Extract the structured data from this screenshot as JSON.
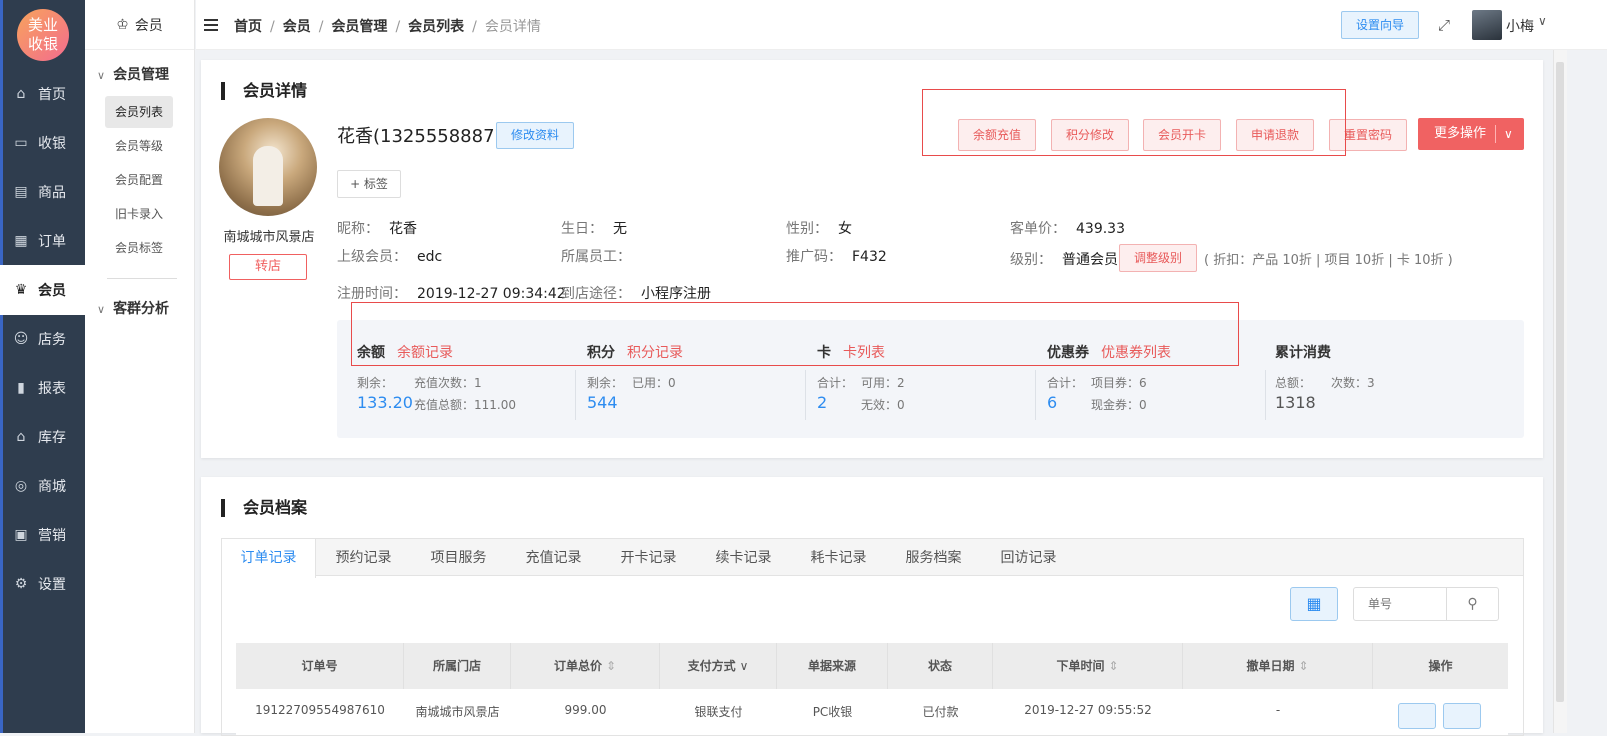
{
  "app": {
    "logo_line1": "美业",
    "logo_line2": "收银"
  },
  "left_nav": [
    {
      "label": "首页",
      "icon": "home-icon",
      "glyph": "⌂"
    },
    {
      "label": "收银",
      "icon": "cashier-icon",
      "glyph": "▭"
    },
    {
      "label": "商品",
      "icon": "goods-icon",
      "glyph": "▤"
    },
    {
      "label": "订单",
      "icon": "order-icon",
      "glyph": "▦"
    },
    {
      "label": "会员",
      "icon": "crown-icon",
      "glyph": "♛"
    },
    {
      "label": "店务",
      "icon": "staff-icon",
      "glyph": "☺"
    },
    {
      "label": "报表",
      "icon": "report-icon",
      "glyph": "▮"
    },
    {
      "label": "库存",
      "icon": "warehouse-icon",
      "glyph": "⌂"
    },
    {
      "label": "商城",
      "icon": "mall-icon",
      "glyph": "◎"
    },
    {
      "label": "营销",
      "icon": "gift-icon",
      "glyph": "▣"
    },
    {
      "label": "设置",
      "icon": "gear-icon",
      "glyph": "⚙"
    }
  ],
  "sub_nav": {
    "title": "会员",
    "group1": "会员管理",
    "items": [
      "会员列表",
      "会员等级",
      "会员配置",
      "旧卡录入",
      "会员标签"
    ],
    "group2": "客群分析"
  },
  "topbar": {
    "crumbs": [
      "首页",
      "会员",
      "会员管理",
      "会员列表"
    ],
    "current": "会员详情",
    "guide_btn": "设置向导",
    "user": "小梅"
  },
  "detail": {
    "title": "会员详情",
    "name": "花香(13255588877)",
    "edit_btn": "修改资料",
    "tag_btn": "+ 标签",
    "store": "南城城市风景店",
    "transfer_btn": "转店",
    "actions": [
      "余额充值",
      "积分修改",
      "会员开卡",
      "申请退款",
      "重置密码"
    ],
    "more_btn": "更多操作",
    "fields": {
      "nickname_k": "昵称：",
      "nickname_v": "花香",
      "birthday_k": "生日：",
      "birthday_v": "无",
      "gender_k": "性别：",
      "gender_v": "女",
      "avg_k": "客单价：",
      "avg_v": "439.33",
      "parent_k": "上级会员：",
      "parent_v": "edc",
      "staff_k": "所属员工：",
      "staff_v": "",
      "promo_k": "推广码：",
      "promo_v": "F432",
      "level_k": "级别：",
      "level_v": "普通会员",
      "level_btn": "调整级别",
      "level_note": "( 折扣：产品 10折 | 项目 10折 | 卡 10折 )",
      "reg_k": "注册时间：",
      "reg_v": "2019-12-27 09:34:42",
      "channel_k": "到店途径：",
      "channel_v": "小程序注册"
    }
  },
  "stats": [
    {
      "title": "余额",
      "link": "余额记录",
      "k1": "剩余：",
      "v1": "133.20",
      "k2": "充值次数：1",
      "k3": "充值总额：111.00"
    },
    {
      "title": "积分",
      "link": "积分记录",
      "k1": "剩余：",
      "v1": "544",
      "k2": "已用：0",
      "k3": ""
    },
    {
      "title": "卡",
      "link": "卡列表",
      "k1": "合计：",
      "v1": "2",
      "k2": "可用：2",
      "k3": "无效：0"
    },
    {
      "title": "优惠券",
      "link": "优惠券列表",
      "k1": "合计：",
      "v1": "6",
      "k2": "项目券：6",
      "k3": "现金券：0"
    },
    {
      "title": "累计消费",
      "link": "",
      "k1": "总额：",
      "v1": "1318",
      "k2": "次数：3",
      "k3": ""
    }
  ],
  "archive": {
    "title": "会员档案",
    "tabs": [
      "订单记录",
      "预约记录",
      "项目服务",
      "充值记录",
      "开卡记录",
      "续卡记录",
      "耗卡记录",
      "服务档案",
      "回访记录"
    ],
    "search_placeholder": "单号",
    "columns": [
      "订单号",
      "所属门店",
      "订单总价",
      "支付方式",
      "单据来源",
      "状态",
      "下单时间",
      "撤单日期",
      "操作"
    ],
    "row": [
      "19122709554987610",
      "南城城市风景店",
      "999.00",
      "银联支付",
      "PC收银",
      "已付款",
      "2019-12-27 09:55:52",
      "-"
    ]
  }
}
